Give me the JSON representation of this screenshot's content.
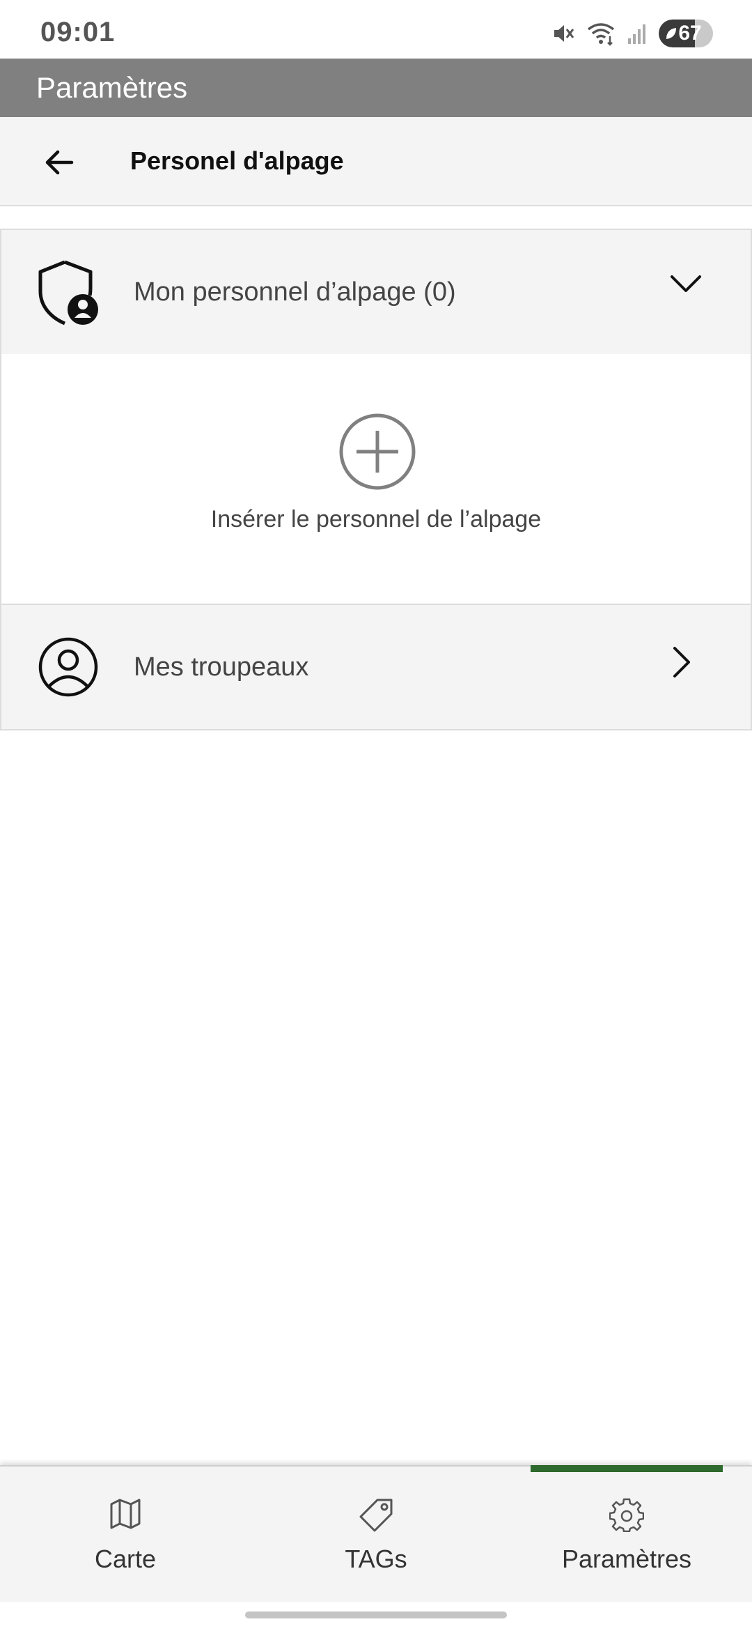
{
  "status_bar": {
    "time": "09:01",
    "battery": "67",
    "battery_level": 0.67,
    "icons": [
      "mute-icon",
      "wifi-icon",
      "signal-icon",
      "battery-icon"
    ]
  },
  "app_header": {
    "title": "Paramètres"
  },
  "sub_header": {
    "title": "Personel d'alpage",
    "back_icon": "arrow-left-icon"
  },
  "sections": {
    "staff": {
      "label": "Mon personnel d’alpage (0)",
      "icon": "shield-person-icon",
      "expanded": true,
      "add_label": "Insérer le personnel de l’alpage",
      "add_icon": "plus-circle-icon"
    },
    "herds": {
      "label": "Mes troupeaux",
      "icon": "user-circle-icon"
    }
  },
  "bottom_nav": {
    "items": [
      {
        "label": "Carte",
        "icon": "map-icon"
      },
      {
        "label": "TAGs",
        "icon": "tag-icon"
      },
      {
        "label": "Paramètres",
        "icon": "gear-icon"
      }
    ],
    "active_index": 2,
    "accent_color": "#2e6a2e"
  },
  "colors": {
    "header_bg": "#808080",
    "section_bg": "#f4f4f4"
  }
}
